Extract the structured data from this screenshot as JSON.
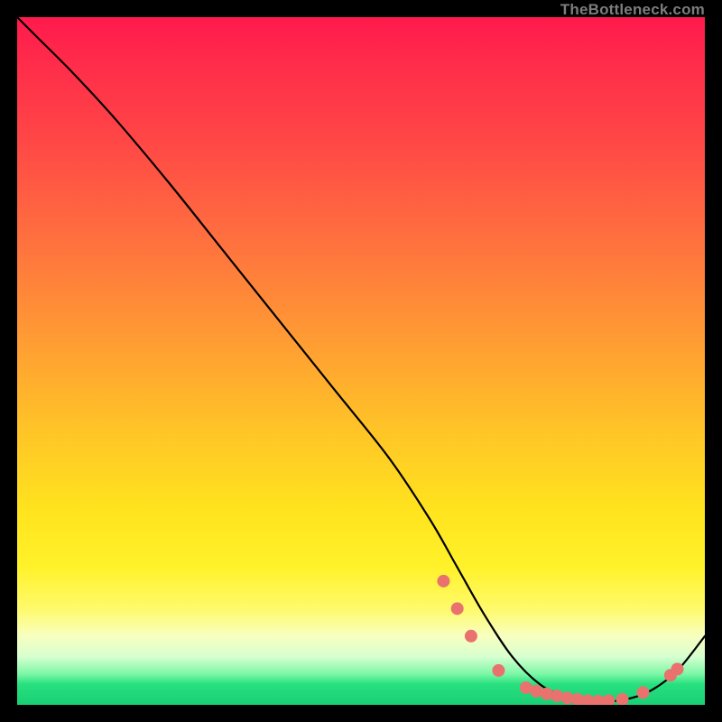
{
  "watermark": "TheBottleneck.com",
  "colors": {
    "curve_stroke": "#000000",
    "marker_fill": "#E9726E",
    "marker_stroke": "#E9726E"
  },
  "chart_data": {
    "type": "line",
    "title": "",
    "xlabel": "",
    "ylabel": "",
    "xlim": [
      0,
      100
    ],
    "ylim": [
      0,
      100
    ],
    "grid": false,
    "legend": false,
    "series": [
      {
        "name": "curve",
        "x": [
          0,
          3,
          8,
          14,
          22,
          30,
          38,
          46,
          54,
          60,
          64,
          68,
          72,
          76,
          80,
          84,
          88,
          92,
          96,
          100
        ],
        "y": [
          100,
          97,
          92,
          85.5,
          76,
          66,
          56,
          46,
          36,
          27,
          20,
          13,
          7,
          3,
          1,
          0.5,
          0.7,
          2,
          5,
          10
        ]
      }
    ],
    "markers": [
      {
        "x": 62,
        "y": 18
      },
      {
        "x": 64,
        "y": 14
      },
      {
        "x": 66,
        "y": 10
      },
      {
        "x": 70,
        "y": 5
      },
      {
        "x": 74,
        "y": 2.5
      },
      {
        "x": 75.5,
        "y": 2
      },
      {
        "x": 77,
        "y": 1.6
      },
      {
        "x": 78.5,
        "y": 1.3
      },
      {
        "x": 80,
        "y": 1
      },
      {
        "x": 81.5,
        "y": 0.8
      },
      {
        "x": 83,
        "y": 0.6
      },
      {
        "x": 84.5,
        "y": 0.55
      },
      {
        "x": 86,
        "y": 0.6
      },
      {
        "x": 88,
        "y": 0.8
      },
      {
        "x": 91,
        "y": 1.8
      },
      {
        "x": 95,
        "y": 4.3
      },
      {
        "x": 96,
        "y": 5.2
      }
    ]
  }
}
